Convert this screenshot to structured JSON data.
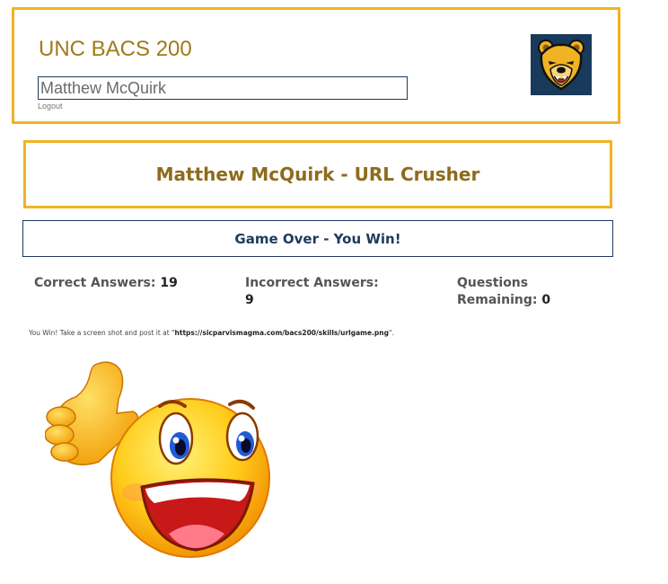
{
  "header": {
    "site_title": "UNC BACS 200",
    "user_name": "Matthew McQuirk",
    "logout_label": "Logout",
    "logo_icon": "bear-mascot-logo-icon"
  },
  "game": {
    "title": "Matthew McQuirk - URL Crusher",
    "status": "Game Over - You Win!"
  },
  "stats": {
    "correct_label": "Correct Answers:",
    "correct_value": "19",
    "incorrect_label": "Incorrect Answers:",
    "incorrect_value": "9",
    "remaining_label": "Questions Remaining:",
    "remaining_value": "0"
  },
  "message": {
    "prefix": "You Win! Take a screen shot and post it at \"",
    "url": "https://sicparvismagma.com/bacs200/skills/urlgame.png",
    "suffix": "\"."
  },
  "image": {
    "icon": "thumbs-up-smiley-emoji-icon"
  },
  "colors": {
    "gold": "#f0b323",
    "navy": "#1e3a5c",
    "title_gold": "#8e6b1c"
  }
}
